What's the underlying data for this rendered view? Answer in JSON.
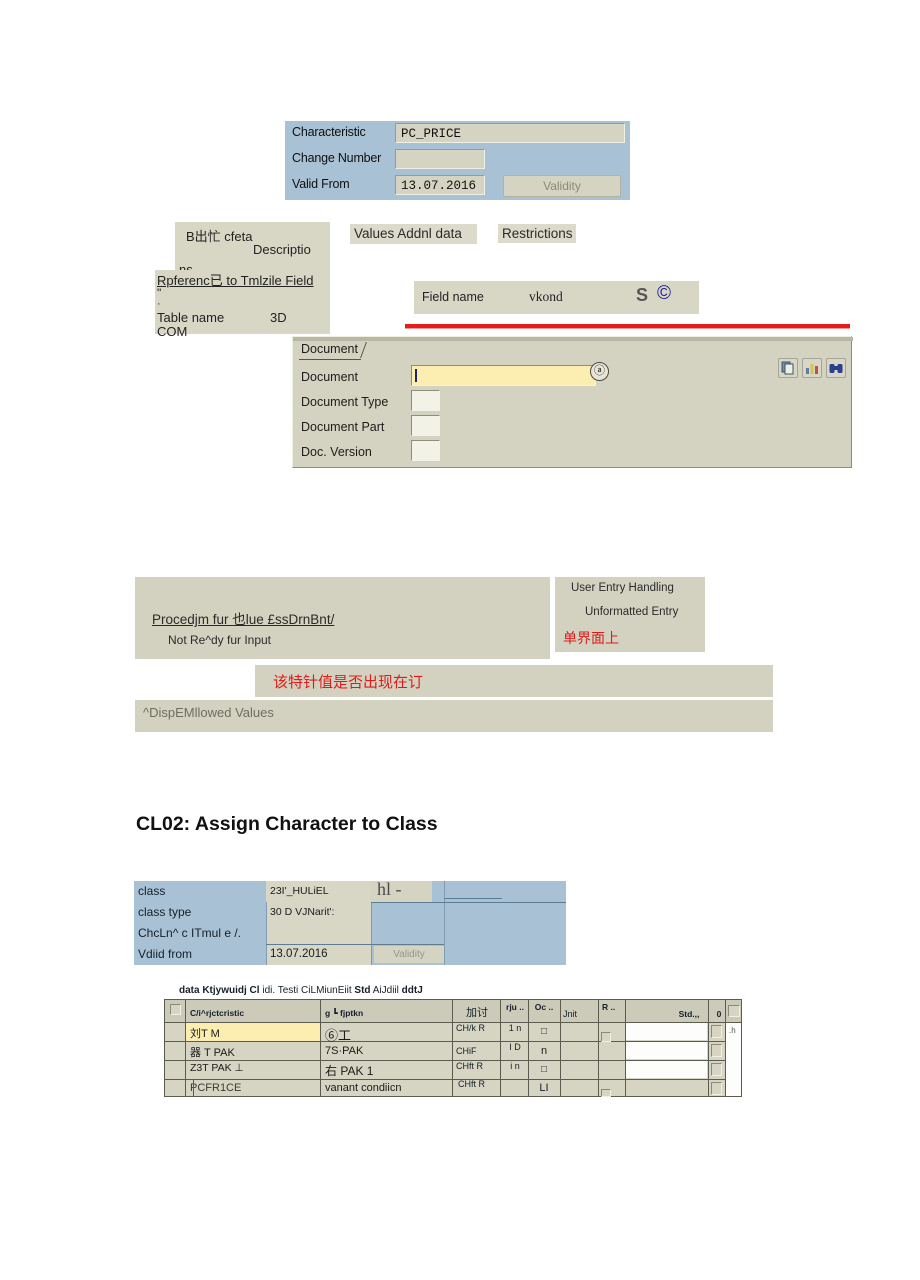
{
  "characteristic_header": {
    "rows": [
      {
        "label": "Characteristic",
        "value": "PC_PRICE"
      },
      {
        "label": "Change Number",
        "value": ""
      },
      {
        "label": "Valid From",
        "value": "13.07.2016"
      }
    ],
    "validity_button": "Validity"
  },
  "description_panel": {
    "line1": "B出忙 cfeta",
    "line2": "Descriptio",
    "line3": "ns",
    "reference_link": "Rpferenc已 to Tmlzile Field",
    "quote_mark": "\"",
    "dash_mark": "·",
    "table_name_label": "Table name",
    "table_name_value": "3D",
    "com_label": "COM"
  },
  "tabs": [
    {
      "label": "Values Addnl data"
    },
    {
      "label": "Restrictions"
    }
  ],
  "field_name_box": {
    "label": "Field name",
    "value": "vkond",
    "marker_s": "S",
    "marker_c": "©"
  },
  "document_dialog": {
    "tab_label": "Document",
    "rows": [
      {
        "label": "Document",
        "value": "",
        "placeholder": ""
      },
      {
        "label": "Document Type",
        "value": ""
      },
      {
        "label": "Document Part",
        "value": ""
      },
      {
        "label": "Doc. Version",
        "value": ""
      }
    ],
    "lookup_icon": "ⓐ",
    "toolbar": [
      {
        "icon": "copy-icon"
      },
      {
        "icon": "chart-icon"
      },
      {
        "icon": "binoculars-icon"
      }
    ]
  },
  "procedure_notes": {
    "title": "Procedjm fur 也lue £ssDrnBnt/",
    "subtitle": "Not Re^dy fur Input",
    "user_entry_handling": "User Entry Handling",
    "unformatted_entry": "Unformatted Entry",
    "annotation_cn_1": "单界面上",
    "annotation_cn_2": "该特针值是否出现在订",
    "display_allowed_values": "^DispEMllowed Values"
  },
  "cl02_heading": "CL02: Assign Character to Class",
  "class_table": {
    "rows": [
      {
        "label": "class",
        "value": "23I'_HULiEL"
      },
      {
        "label": "class type",
        "value": "30 D    VJNarit':"
      },
      {
        "label": "ChcLn^ c ITmul е /.",
        "value": ""
      },
      {
        "label": "Vdiid from",
        "value": "13.07.2016"
      }
    ],
    "validity_button": "Validity",
    "corner_text": "hl -"
  },
  "char_grid": {
    "caption_parts": [
      {
        "text": "data Ktjywuidj Cl",
        "bold": true
      },
      {
        "text": " idi. Testi CiLMiunEiit ",
        "bold": false
      },
      {
        "text": "Std",
        "bold": true
      },
      {
        "text": " AiJdiil ",
        "bold": false
      },
      {
        "text": "ddtJ",
        "bold": true
      }
    ],
    "headers": [
      "",
      "C/i^rjctcristic",
      "g ┗  fjptkn",
      "加讨",
      "rju ..",
      "Oc ..",
      "Jnit",
      "R ..",
      "",
      "Std.,,",
      "0",
      ""
    ],
    "rows": [
      {
        "select": "",
        "characteristic": "刘T M",
        "description": "⑥工",
        "col4": "CH/k R",
        "col5": "1 n",
        "col6": "□",
        "unit": "",
        "r": "",
        "blank": "",
        "std": "",
        "zero": "",
        "last": ".h"
      },
      {
        "select": "",
        "characteristic": "器  T PAK",
        "description": "7S·PAK",
        "col4": "CHiF",
        "col5": "I D",
        "col6": "n",
        "unit": "",
        "r": "",
        "blank": "",
        "std": "",
        "zero": "",
        "last": ""
      },
      {
        "select": "",
        "characteristic": "Z3T PAK ⊥",
        "description": "右  PAK 1",
        "col4": "CHft R",
        "col5": "i n",
        "col6": "□",
        "unit": "",
        "r": "",
        "blank": "",
        "std": "",
        "zero": "",
        "last": ""
      },
      {
        "select": "",
        "characteristic": "PCFR1CE",
        "description": "vanant condiicn",
        "col4": "CHft R",
        "col5": "",
        "col6": "LI",
        "unit": "",
        "r": "",
        "blank": "",
        "std": "",
        "zero": "",
        "last": ""
      }
    ]
  },
  "colors": {
    "blue_panel": "#a8c1d4",
    "beige": "#d8d7c6",
    "field_grey": "#d5d4c2",
    "field_yellow": "#fbeeb0",
    "accent_red": "#e81b1b",
    "annotation_red": "#e01b1b"
  }
}
